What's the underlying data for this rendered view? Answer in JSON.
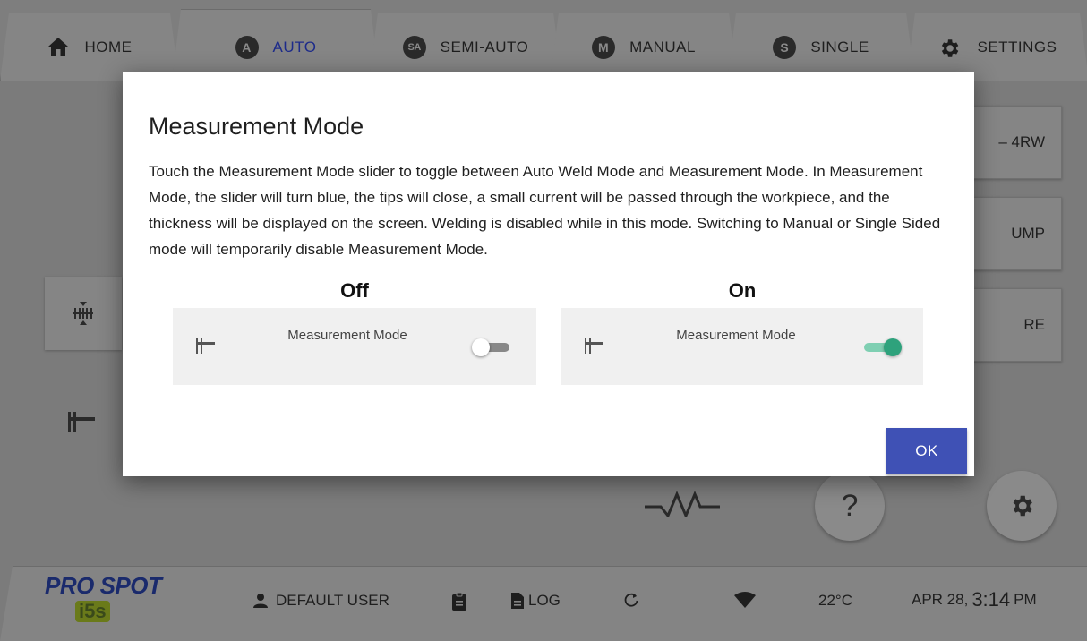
{
  "tabs": [
    {
      "label": "HOME",
      "icon": "home-icon"
    },
    {
      "label": "AUTO",
      "badge": "A",
      "active": true
    },
    {
      "label": "SEMI-AUTO",
      "badge": "SA"
    },
    {
      "label": "MANUAL",
      "badge": "M"
    },
    {
      "label": "SINGLE",
      "badge": "S"
    },
    {
      "label": "SETTINGS",
      "icon": "gear-icon"
    }
  ],
  "background_buttons": [
    {
      "label": "– 4RW"
    },
    {
      "label": "UMP"
    },
    {
      "label": "RE"
    }
  ],
  "help_fab": "?",
  "dialog": {
    "title": "Measurement Mode",
    "body": "Touch the Measurement Mode slider to toggle between Auto Weld Mode and Measurement Mode. In Measurement Mode, the slider will turn blue, the tips will close, a small current will be passed through the workpiece, and the thickness will be displayed on the screen. Welding is disabled while in this mode. Switching to Manual or Single Sided mode will temporarily disable Measurement Mode.",
    "examples": [
      {
        "heading": "Off",
        "label": "Measurement Mode",
        "state": "off"
      },
      {
        "heading": "On",
        "label": "Measurement Mode",
        "state": "on"
      }
    ],
    "ok_label": "OK"
  },
  "status": {
    "logo_text": "PRO SPOT",
    "logo_sub": "i5s",
    "user": "DEFAULT USER",
    "log": "LOG",
    "temperature": "22°C",
    "date": "APR 28,",
    "time": "3:14",
    "ampm": "PM"
  },
  "colors": {
    "ok_button": "#3f51b5",
    "toggle_on": "#2ea27c",
    "active_tab_text": "#1d2b8a"
  }
}
